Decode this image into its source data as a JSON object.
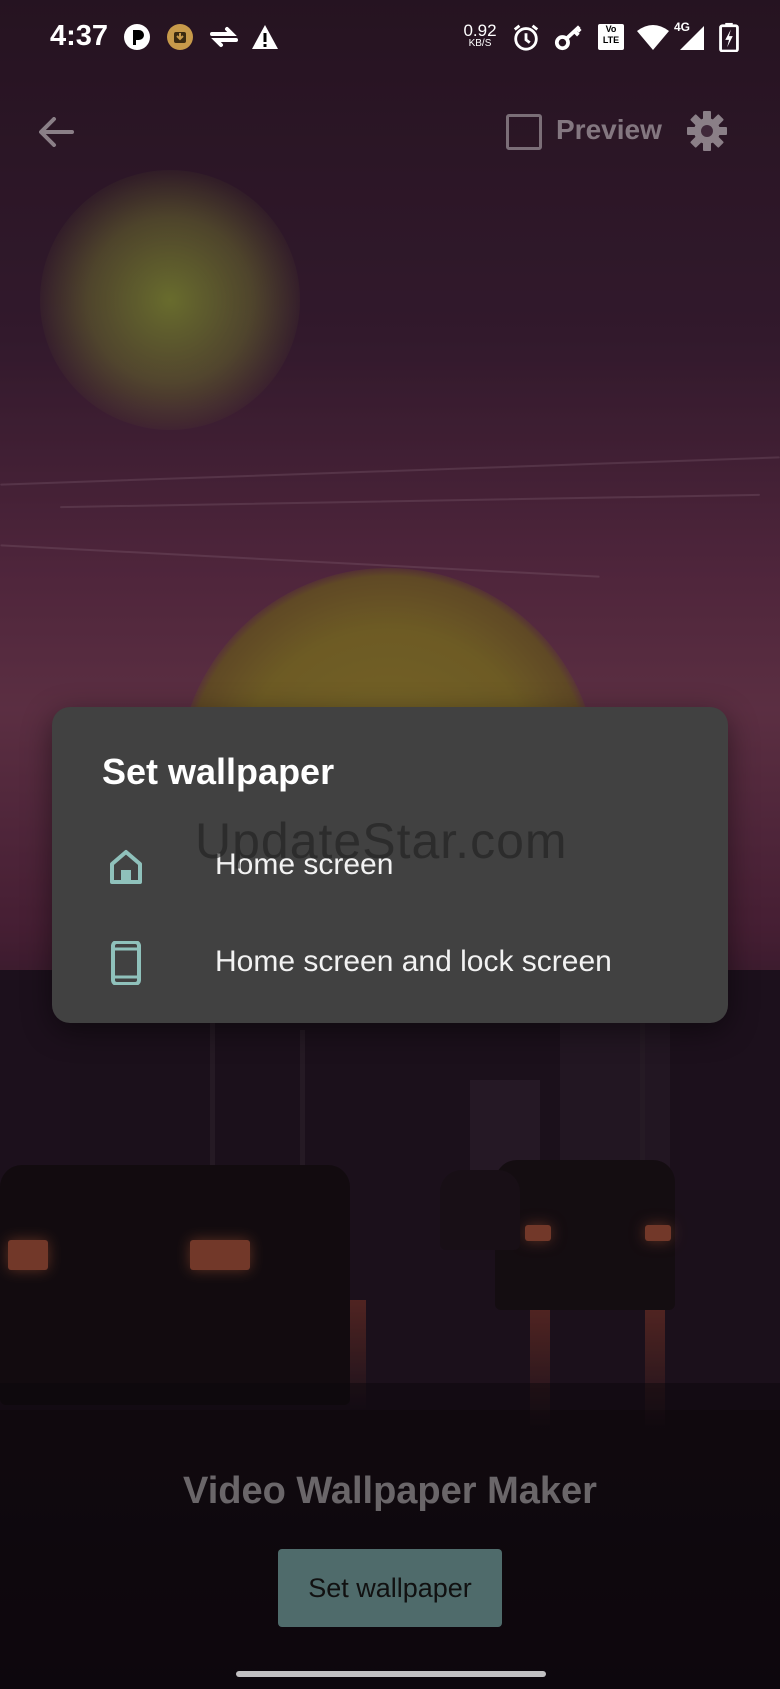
{
  "status_bar": {
    "time": "4:37",
    "net_speed_value": "0.92",
    "net_speed_unit": "KB/S",
    "volte_label": "Vo LTE",
    "network_type": "4G",
    "icons": [
      "p-app-icon",
      "download-icon",
      "sync-icon",
      "warning-icon",
      "alarm-icon",
      "key-icon",
      "volte-icon",
      "wifi-icon",
      "signal-icon",
      "battery-charging-icon"
    ]
  },
  "top_bar": {
    "preview_label": "Preview",
    "preview_checked": false
  },
  "dialog": {
    "title": "Set wallpaper",
    "options": [
      {
        "label": "Home screen",
        "icon": "home-icon"
      },
      {
        "label": "Home screen and lock screen",
        "icon": "phone-icon"
      }
    ],
    "icon_color": "#8fc1bb"
  },
  "watermark": "UpdateStar.com",
  "app_title": "Video Wallpaper Maker",
  "set_wallpaper_button": "Set wallpaper"
}
